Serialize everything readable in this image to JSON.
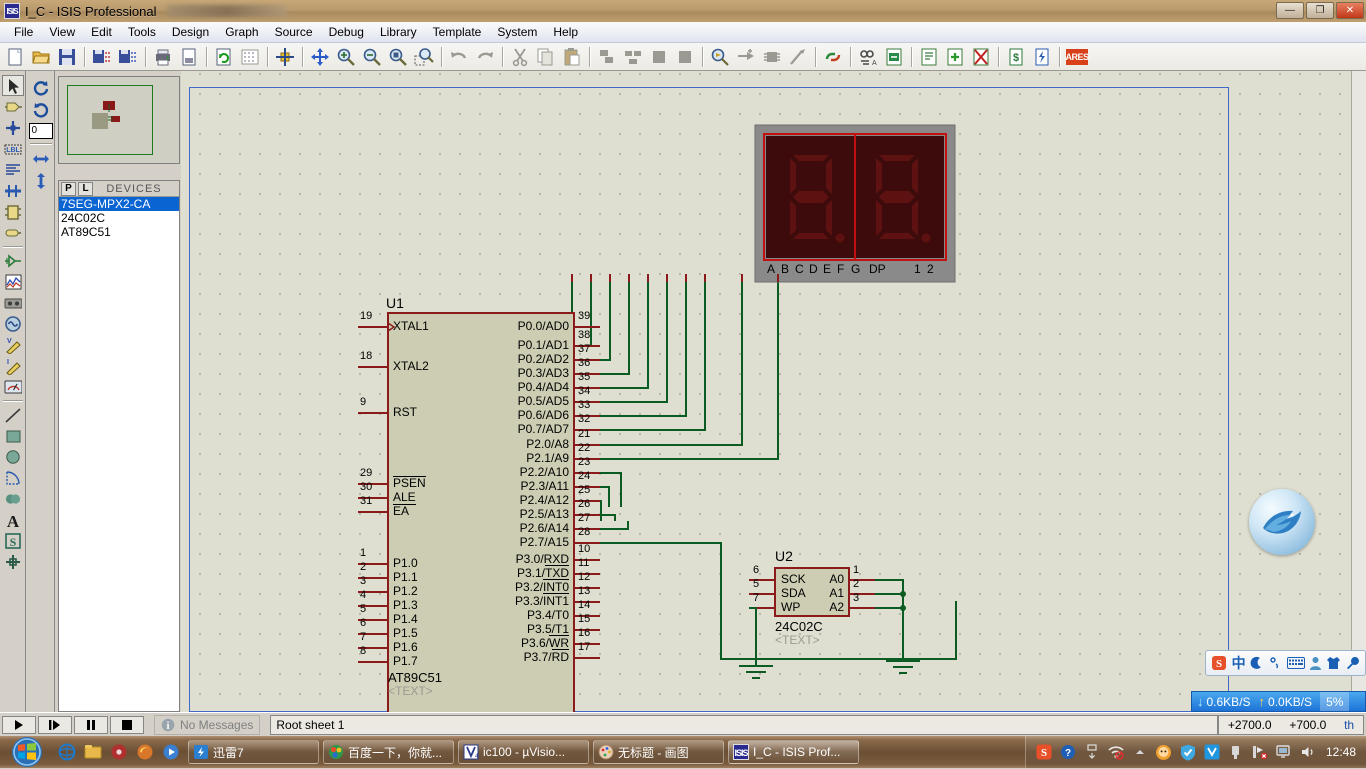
{
  "window": {
    "title": "I_C - ISIS Professional",
    "app_icon": "isis-icon",
    "minimize": "—",
    "maximize": "❐",
    "close": "✕"
  },
  "menubar": {
    "items": [
      "File",
      "View",
      "Edit",
      "Tools",
      "Design",
      "Graph",
      "Source",
      "Debug",
      "Library",
      "Template",
      "System",
      "Help"
    ]
  },
  "toolbar": {
    "groups": [
      {
        "icons": [
          "new-file-icon",
          "open-file-icon",
          "save-file-icon"
        ]
      },
      {
        "icons": [
          "import-section-icon",
          "export-section-icon"
        ]
      },
      {
        "icons": [
          "print-icon",
          "print-area-icon"
        ]
      },
      {
        "icons": [
          "refresh-icon",
          "toggle-grid-icon"
        ]
      },
      {
        "icons": [
          "origin-icon"
        ]
      },
      {
        "icons": [
          "pan-icon",
          "zoom-in-icon",
          "zoom-out-icon",
          "zoom-all-icon",
          "zoom-area-icon"
        ]
      },
      {
        "icons": [
          "undo-icon",
          "redo-icon"
        ]
      },
      {
        "icons": [
          "cut-icon",
          "copy-icon",
          "paste-icon"
        ]
      },
      {
        "icons": [
          "block-copy-icon",
          "block-move-icon",
          "block-rotate-icon",
          "block-delete-icon"
        ]
      },
      {
        "icons": [
          "pick-device-icon",
          "make-device-icon",
          "package-tool-icon",
          "decompose-icon"
        ]
      },
      {
        "icons": [
          "wire-label-icon"
        ]
      },
      {
        "icons": [
          "property-assign-icon",
          "design-explorer-icon"
        ]
      },
      {
        "icons": [
          "new-sheet-icon",
          "remove-sheet-icon",
          "exit-sheet-icon"
        ]
      },
      {
        "icons": [
          "bill-of-materials-icon",
          "electrical-rule-check-icon"
        ]
      },
      {
        "icons": [
          "ares-icon"
        ]
      }
    ],
    "ares_label": "ARES"
  },
  "lefttools": {
    "items": [
      {
        "name": "selection-mode-icon",
        "selected": true
      },
      {
        "name": "component-mode-icon",
        "selected": false
      },
      {
        "name": "junction-dot-mode-icon",
        "selected": false
      },
      {
        "name": "wire-label-mode-icon",
        "selected": false
      },
      {
        "name": "text-script-mode-icon",
        "selected": false
      },
      {
        "name": "buses-mode-icon",
        "selected": false
      },
      {
        "name": "subcircuit-mode-icon",
        "selected": false
      },
      {
        "name": "terminals-mode-icon",
        "selected": false
      },
      {
        "name": "device-pin-mode-icon",
        "selected": false
      },
      {
        "name": "graph-mode-icon",
        "selected": false
      },
      {
        "name": "tape-recorder-mode-icon",
        "selected": false
      },
      {
        "name": "generator-mode-icon",
        "selected": false
      },
      {
        "name": "voltage-probe-mode-icon",
        "selected": false
      },
      {
        "name": "current-probe-mode-icon",
        "selected": false
      },
      {
        "name": "virtual-instrument-mode-icon",
        "selected": false
      },
      {
        "name": "line-tool-icon",
        "selected": false
      },
      {
        "name": "box-tool-icon",
        "selected": false
      },
      {
        "name": "circle-tool-icon",
        "selected": false
      },
      {
        "name": "arc-tool-icon",
        "selected": false
      },
      {
        "name": "path-tool-icon",
        "selected": false
      },
      {
        "name": "text-tool-icon",
        "selected": false
      },
      {
        "name": "symbol-tool-icon",
        "selected": false
      },
      {
        "name": "marker-tool-icon",
        "selected": false
      }
    ]
  },
  "rotation_panel": {
    "rotate_cw_icon": "rotate-clockwise-icon",
    "rotate_ccw_icon": "rotate-counterclockwise-icon",
    "angle_value": "0",
    "mirror_x_icon": "mirror-horizontal-icon",
    "mirror_y_icon": "mirror-vertical-icon"
  },
  "devices_panel": {
    "tab_p": "P",
    "tab_l": "L",
    "title": "DEVICES",
    "items": [
      {
        "label": "7SEG-MPX2-CA",
        "selected": true
      },
      {
        "label": "24C02C",
        "selected": false
      },
      {
        "label": "AT89C51",
        "selected": false
      }
    ]
  },
  "schematic": {
    "display": {
      "ref": "7SEG-MPX2-CA",
      "segment_labels": [
        "A",
        "B",
        "C",
        "D",
        "E",
        "F",
        "G"
      ],
      "dp_label": "DP",
      "digit_labels": [
        "1",
        "2"
      ],
      "body_color": "#8a8a8a",
      "face_color": "#3d0b0b",
      "segment_color": "#5e1111",
      "frame_color": "#c01010"
    },
    "u1": {
      "ref": "U1",
      "part": "AT89C51",
      "text_placeholder": "<TEXT>",
      "left_pins": [
        {
          "num": "19",
          "label": "XTAL1"
        },
        {
          "num": "18",
          "label": "XTAL2"
        },
        {
          "num": "9",
          "label": "RST"
        },
        {
          "num": "29",
          "label": "PSEN",
          "bar": "over"
        },
        {
          "num": "30",
          "label": "ALE",
          "bar": "under"
        },
        {
          "num": "31",
          "label": "EA",
          "bar": "none"
        },
        {
          "num": "1",
          "label": "P1.0"
        },
        {
          "num": "2",
          "label": "P1.1"
        },
        {
          "num": "3",
          "label": "P1.2"
        },
        {
          "num": "4",
          "label": "P1.3"
        },
        {
          "num": "5",
          "label": "P1.4"
        },
        {
          "num": "6",
          "label": "P1.5"
        },
        {
          "num": "7",
          "label": "P1.6"
        },
        {
          "num": "8",
          "label": "P1.7"
        }
      ],
      "right_pins": [
        {
          "num": "39",
          "label": "P0.0/AD0"
        },
        {
          "num": "38",
          "label": "P0.1/AD1"
        },
        {
          "num": "37",
          "label": "P0.2/AD2"
        },
        {
          "num": "36",
          "label": "P0.3/AD3"
        },
        {
          "num": "35",
          "label": "P0.4/AD4"
        },
        {
          "num": "34",
          "label": "P0.5/AD5"
        },
        {
          "num": "33",
          "label": "P0.6/AD6"
        },
        {
          "num": "32",
          "label": "P0.7/AD7"
        },
        {
          "num": "21",
          "label": "P2.0/A8"
        },
        {
          "num": "22",
          "label": "P2.1/A9"
        },
        {
          "num": "23",
          "label": "P2.2/A10"
        },
        {
          "num": "24",
          "label": "P2.3/A11"
        },
        {
          "num": "25",
          "label": "P2.4/A12"
        },
        {
          "num": "26",
          "label": "P2.5/A13"
        },
        {
          "num": "27",
          "label": "P2.6/A14"
        },
        {
          "num": "28",
          "label": "P2.7/A15"
        },
        {
          "num": "10",
          "label": "P3.0/RXD"
        },
        {
          "num": "11",
          "label": "P3.1/TXD"
        },
        {
          "num": "12",
          "label": "P3.2/INT0"
        },
        {
          "num": "13",
          "label": "P3.3/INT1"
        },
        {
          "num": "14",
          "label": "P3.4/T0"
        },
        {
          "num": "15",
          "label": "P3.5/T1"
        },
        {
          "num": "16",
          "label": "P3.6/WR"
        },
        {
          "num": "17",
          "label": "P3.7/RD"
        }
      ]
    },
    "u2": {
      "ref": "U2",
      "part": "24C02C",
      "text_placeholder": "<TEXT>",
      "left_pins": [
        {
          "num": "6",
          "label": "SCK"
        },
        {
          "num": "5",
          "label": "SDA"
        },
        {
          "num": "7",
          "label": "WP"
        }
      ],
      "right_pins": [
        {
          "num": "1",
          "label": "A0"
        },
        {
          "num": "2",
          "label": "A1"
        },
        {
          "num": "3",
          "label": "A2"
        }
      ]
    },
    "colors": {
      "wire": "#0a5c22",
      "pin": "#8b1a1a",
      "body_fill": "#cdcdb4",
      "body_stroke": "#8b1a1a",
      "sheet_border": "#4169c8",
      "canvas_bg": "#dedfd0"
    }
  },
  "statusbar": {
    "animate_buttons": [
      "play-icon",
      "step-icon",
      "pause-icon",
      "stop-icon"
    ],
    "message": "No Messages",
    "message_icon": "info-icon",
    "sheet": "Root sheet 1",
    "coord_x": "+2700.0",
    "coord_y": "+700.0",
    "units": "th"
  },
  "netspeed": {
    "down_icon": "download-arrow-icon",
    "down": "0.6KB/S",
    "up_icon": "upload-arrow-icon",
    "up": "0.0KB/S",
    "cpu": "5%"
  },
  "ime": {
    "items": [
      "sogou-logo-icon",
      "chinese-mode-icon",
      "moon-icon",
      "punctuation-icon",
      "keyboard-icon",
      "user-icon",
      "skin-icon",
      "tools-icon"
    ],
    "chinese_glyph": "中"
  },
  "taskbar": {
    "start_icon": "windows-start-icon",
    "quicklaunch": [
      "ie-icon",
      "explorer-icon",
      "media-icon",
      "firefox-icon",
      "player-icon"
    ],
    "items": [
      {
        "label": "迅雷7",
        "icon": "thunder-icon",
        "active": false
      },
      {
        "label": "百度一下，你就...",
        "icon": "baidu-icon",
        "active": false
      },
      {
        "label": "ic100  - µVisio...",
        "icon": "keil-icon",
        "active": false
      },
      {
        "label": "无标题 - 画图",
        "icon": "paint-icon",
        "active": false
      },
      {
        "label": "I_C - ISIS Prof...",
        "icon": "isis-icon",
        "active": true
      }
    ],
    "tray": [
      "sogou-tray-icon",
      "help-tray-icon",
      "show-desktop-icon",
      "wifi-icon",
      "show-hidden-icon",
      "qq-icon",
      "security-shield-icon",
      "tencent-icon",
      "usb-icon",
      "network-error-icon",
      "monitor-icon",
      "volume-icon"
    ],
    "clock": "12:48"
  },
  "desktop_bird": {
    "name": "bird-widget-icon"
  }
}
